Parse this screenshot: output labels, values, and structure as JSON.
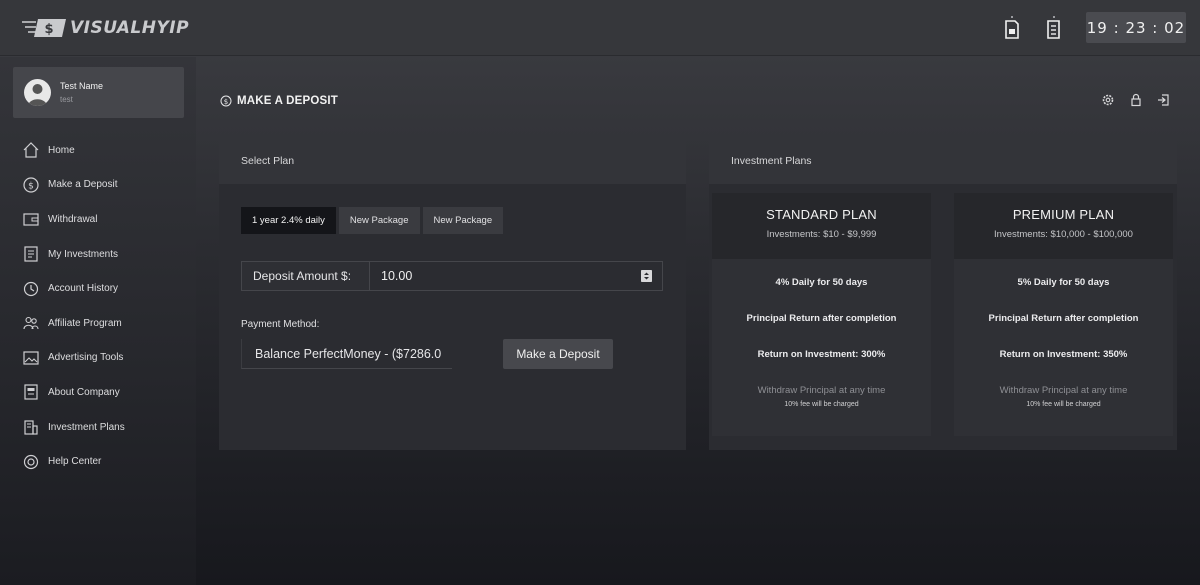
{
  "app": {
    "logo_text": "VISUALHYIP",
    "clock": "19 : 23 : 02"
  },
  "user": {
    "name": "Test Name",
    "username": "test"
  },
  "sidebar": {
    "items": [
      {
        "label": "Home",
        "icon": "home-icon"
      },
      {
        "label": "Make a Deposit",
        "icon": "dollar-circle-icon"
      },
      {
        "label": "Withdrawal",
        "icon": "wallet-icon"
      },
      {
        "label": "My Investments",
        "icon": "document-icon"
      },
      {
        "label": "Account History",
        "icon": "history-icon"
      },
      {
        "label": "Affiliate Program",
        "icon": "users-icon"
      },
      {
        "label": "Advertising Tools",
        "icon": "image-icon"
      },
      {
        "label": "About Company",
        "icon": "info-page-icon"
      },
      {
        "label": "Investment Plans",
        "icon": "building-icon"
      },
      {
        "label": "Help Center",
        "icon": "lifebuoy-icon"
      }
    ]
  },
  "page": {
    "title": "MAKE A DEPOSIT"
  },
  "select_plan": {
    "heading": "Select Plan",
    "tabs": [
      "1 year 2.4% daily",
      "New Package",
      "New Package"
    ],
    "amount_label": "Deposit Amount $:",
    "amount_value": "10.00",
    "payment_label": "Payment Method:",
    "payment_value": "Balance PerfectMoney - ($7286.0",
    "submit_label": "Make a Deposit"
  },
  "investment_plans": {
    "heading": "Investment Plans",
    "plans": [
      {
        "name": "STANDARD PLAN",
        "range": "Investments: $10 - $9,999",
        "daily": "4% Daily for 50 days",
        "principal": "Principal Return after completion",
        "roi_label": "Return on Investment:",
        "roi_value": "300%",
        "withdraw": "Withdraw Principal at any time",
        "fee": "10% fee will be charged"
      },
      {
        "name": "PREMIUM PLAN",
        "range": "Investments: $10,000 - $100,000",
        "daily": "5% Daily for 50 days",
        "principal": "Principal Return after completion",
        "roi_label": "Return on Investment:",
        "roi_value": "350%",
        "withdraw": "Withdraw Principal at any time",
        "fee": "10% fee will be charged"
      }
    ]
  },
  "colors": {
    "background": "#2c2d32",
    "panel": "#2b2c31",
    "active_tab": "#141519"
  }
}
